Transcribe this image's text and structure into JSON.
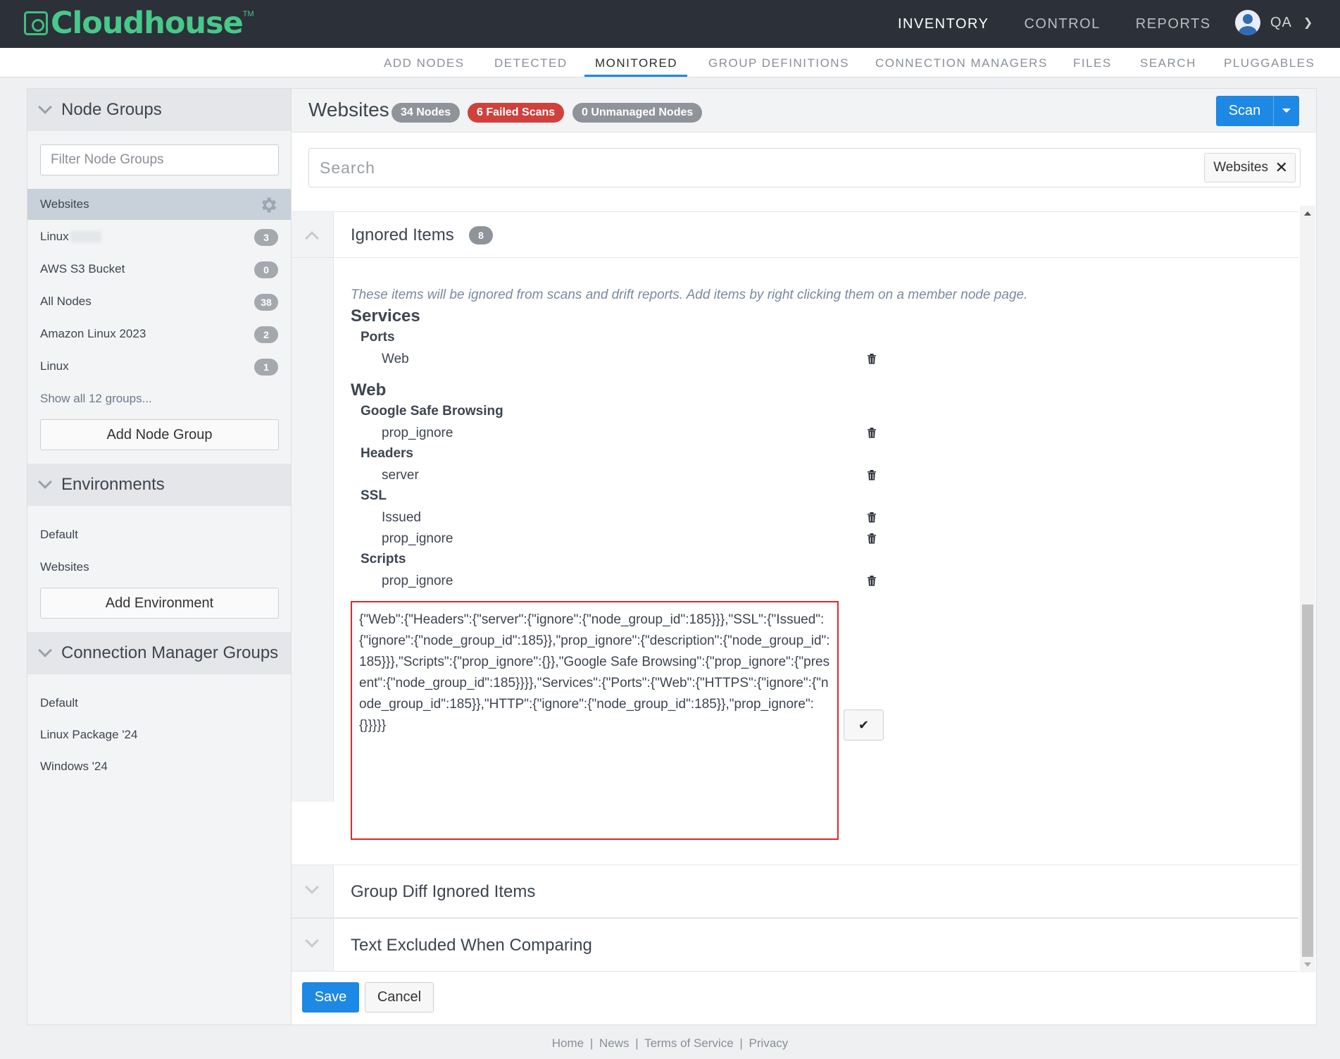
{
  "brand": {
    "name": "Cloudhouse",
    "tm": "TM",
    "color": "#47c98a"
  },
  "topnav": {
    "items": [
      "INVENTORY",
      "CONTROL",
      "REPORTS"
    ],
    "active": "INVENTORY"
  },
  "user": {
    "name": "QA",
    "icon": "user-avatar-icon"
  },
  "subnav": {
    "items": [
      "ADD NODES",
      "DETECTED",
      "MONITORED",
      "GROUP DEFINITIONS",
      "CONNECTION MANAGERS",
      "FILES",
      "SEARCH",
      "PLUGGABLES"
    ],
    "active": "MONITORED"
  },
  "sidebar": {
    "node_groups": {
      "title": "Node Groups",
      "filter_placeholder": "Filter Node Groups",
      "items": [
        {
          "label": "Websites",
          "selected": true
        },
        {
          "label": "Linux",
          "count": "3"
        },
        {
          "label": "AWS S3 Bucket",
          "count": "0"
        },
        {
          "label": "All Nodes",
          "count": "38"
        },
        {
          "label": "Amazon Linux 2023",
          "count": "2"
        },
        {
          "label": "Linux",
          "count": "1"
        }
      ],
      "show_all": "Show all 12 groups...",
      "add_label": "Add Node Group"
    },
    "environments": {
      "title": "Environments",
      "items": [
        "Default",
        "Websites"
      ],
      "add_label": "Add Environment"
    },
    "connection_manager_groups": {
      "title": "Connection Manager Groups",
      "items": [
        "Default",
        "Linux Package '24",
        "Windows '24"
      ]
    }
  },
  "main": {
    "title": "Websites",
    "pills": {
      "nodes": "34 Nodes",
      "failed": "6 Failed Scans",
      "unmanaged": "0 Unmanaged Nodes"
    },
    "scan_label": "Scan",
    "search_placeholder": "Search",
    "search_tag": "Websites",
    "ignored": {
      "title": "Ignored Items",
      "count": "8",
      "hint": "These items will be ignored from scans and drift reports. Add items by right clicking them on a member node page.",
      "services": {
        "title": "Services",
        "ports": "Ports",
        "web": "Web"
      },
      "web": {
        "title": "Web",
        "gsb": "Google Safe Browsing",
        "gsb_item": "prop_ignore",
        "headers": "Headers",
        "headers_item": "server",
        "ssl": "SSL",
        "ssl_issued": "Issued",
        "ssl_prop": "prop_ignore",
        "scripts": "Scripts",
        "scripts_item": "prop_ignore"
      },
      "json": "{\"Web\":{\"Headers\":{\"server\":{\"ignore\":{\"node_group_id\":185}}},\"SSL\":{\"Issued\":{\"ignore\":{\"node_group_id\":185}},\"prop_ignore\":{\"description\":{\"node_group_id\":185}}},\"Scripts\":{\"prop_ignore\":{}},\"Google Safe Browsing\":{\"prop_ignore\":{\"present\":{\"node_group_id\":185}}}},\"Services\":{\"Ports\":{\"Web\":{\"HTTPS\":{\"ignore\":{\"node_group_id\":185}},\"HTTP\":{\"ignore\":{\"node_group_id\":185}},\"prop_ignore\":{}}}}}",
      "confirm_icon": "check-icon"
    },
    "group_diff": {
      "title": "Group Diff Ignored Items"
    },
    "text_excluded": {
      "title": "Text Excluded When Comparing"
    },
    "save_label": "Save",
    "cancel_label": "Cancel"
  },
  "footer": {
    "links": [
      "Home",
      "News",
      "Terms of Service",
      "Privacy"
    ],
    "separator": "|"
  },
  "colors": {
    "primary": "#1e88e5",
    "danger": "#d0403c",
    "topbar": "#2c3038",
    "highlight_border": "#e0282b"
  }
}
